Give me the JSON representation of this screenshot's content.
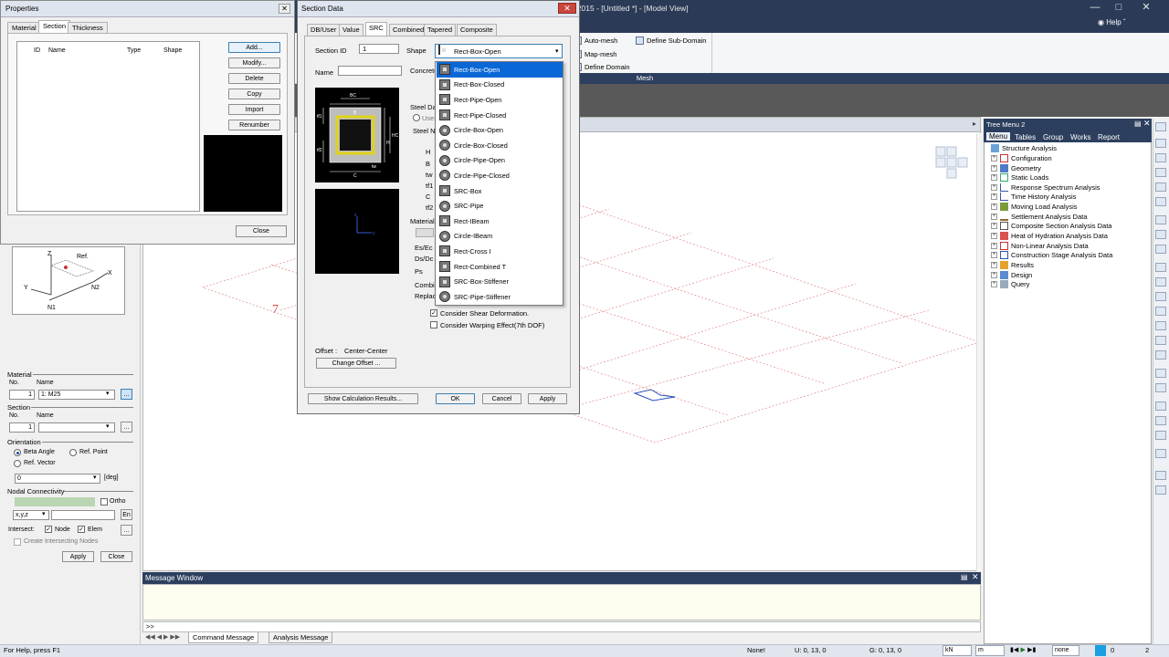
{
  "app": {
    "title": "en 2015 - [Untitled *] - [Model View]",
    "help": "Help"
  },
  "ribbon": {
    "items": [
      "Auto-mesh",
      "Map-mesh",
      "Define Domain",
      "Define Sub-Domain"
    ],
    "group_caption": "Mesh"
  },
  "properties": {
    "title": "Properties",
    "tabs": [
      "Material",
      "Section",
      "Thickness"
    ],
    "columns": [
      "ID",
      "Name",
      "Type",
      "Shape"
    ],
    "buttons": [
      "Add...",
      "Modify...",
      "Delete",
      "Copy",
      "Import",
      "Renumber"
    ],
    "close": "Close"
  },
  "left_panel": {
    "diagram_labels": {
      "z": "Z",
      "y": "Y",
      "ref": "Ref.",
      "x": "X",
      "n1": "N1",
      "n2": "N2"
    },
    "material": {
      "heading": "Material",
      "no_label": "No.",
      "name_label": "Name",
      "no": "1",
      "name": "1: M25"
    },
    "section": {
      "heading": "Section",
      "no_label": "No.",
      "name_label": "Name",
      "no": "1",
      "name": ""
    },
    "orientation": {
      "heading": "Orientation",
      "beta": "Beta Angle",
      "refpoint": "Ref. Point",
      "refvector": "Ref. Vector",
      "angle": "0",
      "unit": "[deg]"
    },
    "nodal": {
      "heading": "Nodal Connectivity",
      "ortho": "Ortho",
      "coord": "x,y,z",
      "en": "En"
    },
    "intersect": {
      "label": "Intersect:",
      "node": "Node",
      "elem": "Elem"
    },
    "create_nodes": "Create Intersecting Nodes",
    "apply": "Apply",
    "close": "Close"
  },
  "section_dialog": {
    "title": "Section Data",
    "tabs": [
      "DB/User",
      "Value",
      "SRC",
      "Combined",
      "Tapered",
      "Composite"
    ],
    "section_id_label": "Section ID",
    "section_id": "1",
    "shape_label": "Shape",
    "name_label": "Name",
    "name_value": "",
    "shape_selected": "Rect-Box-Open",
    "shape_options": [
      "Rect-Box-Open",
      "Rect-Box-Closed",
      "Rect-Pipe-Open",
      "Rect-Pipe-Closed",
      "Circle-Box-Open",
      "Circle-Box-Closed",
      "Circle-Pipe-Open",
      "Circle-Pipe-Closed",
      "SRC-Box",
      "SRC-Pipe",
      "Rect-IBeam",
      "Circle-IBeam",
      "Rect-Cross I",
      "Rect-Combined T",
      "SRC-Box-Stiffener",
      "SRC-Pipe-Stiffener"
    ],
    "dims": [
      "H",
      "B",
      "tw",
      "tf1",
      "C",
      "tf2"
    ],
    "partial_labels": [
      "Concrete",
      "Steel Da",
      "User",
      "Steel N",
      "Material",
      "Es/Ec",
      "Ds/Dc",
      "Ps",
      "Combin",
      "Replac"
    ],
    "drawing_labels": {
      "bc": "BC",
      "hc": "HC",
      "b": "B",
      "h": "H",
      "c": "C",
      "tw": "tw",
      "tf1": "tf1",
      "tf2": "tf2",
      "axis_z": "z",
      "axis_y": "y"
    },
    "shear_def": "Consider Shear Deformation.",
    "warping": "Consider Warping Effect(7th DOF)",
    "offset_label": "Offset :",
    "offset_value": "Center-Center",
    "change_offset": "Change Offset ...",
    "show_calc": "Show Calculation Results...",
    "ok": "OK",
    "cancel": "Cancel",
    "apply": "Apply"
  },
  "model_view": {
    "node_label": "7"
  },
  "message_window": {
    "title": "Message Window",
    "prompt": ">>",
    "tabs": [
      "Command Message",
      "Analysis Message"
    ]
  },
  "tree_menu": {
    "title": "Tree Menu 2",
    "tabs": [
      "Menu",
      "Tables",
      "Group",
      "Works",
      "Report"
    ],
    "items": [
      "Structure Analysis",
      "Configuration",
      "Geometry",
      "Static Loads",
      "Response Spectrum Analysis",
      "Time History Analysis",
      "Moving Load Analysis",
      "Settlement Analysis Data",
      "Composite Section Analysis Data",
      "Heat of Hydration Analysis Data",
      "Non-Linear Analysis Data",
      "Construction Stage Analysis Data",
      "Results",
      "Design",
      "Query"
    ]
  },
  "status": {
    "help": "For Help, press F1",
    "none_label": "None!",
    "u": "U: 0, 13, 0",
    "g": "G: 0, 13, 0",
    "force_unit": "kN",
    "length_unit": "m",
    "mode": "none",
    "num1": "0",
    "num2": "2"
  },
  "colors": {
    "title_bar": "#2b3b57",
    "selection": "#0a68d6",
    "panel_caption": "#2c3f5e"
  }
}
